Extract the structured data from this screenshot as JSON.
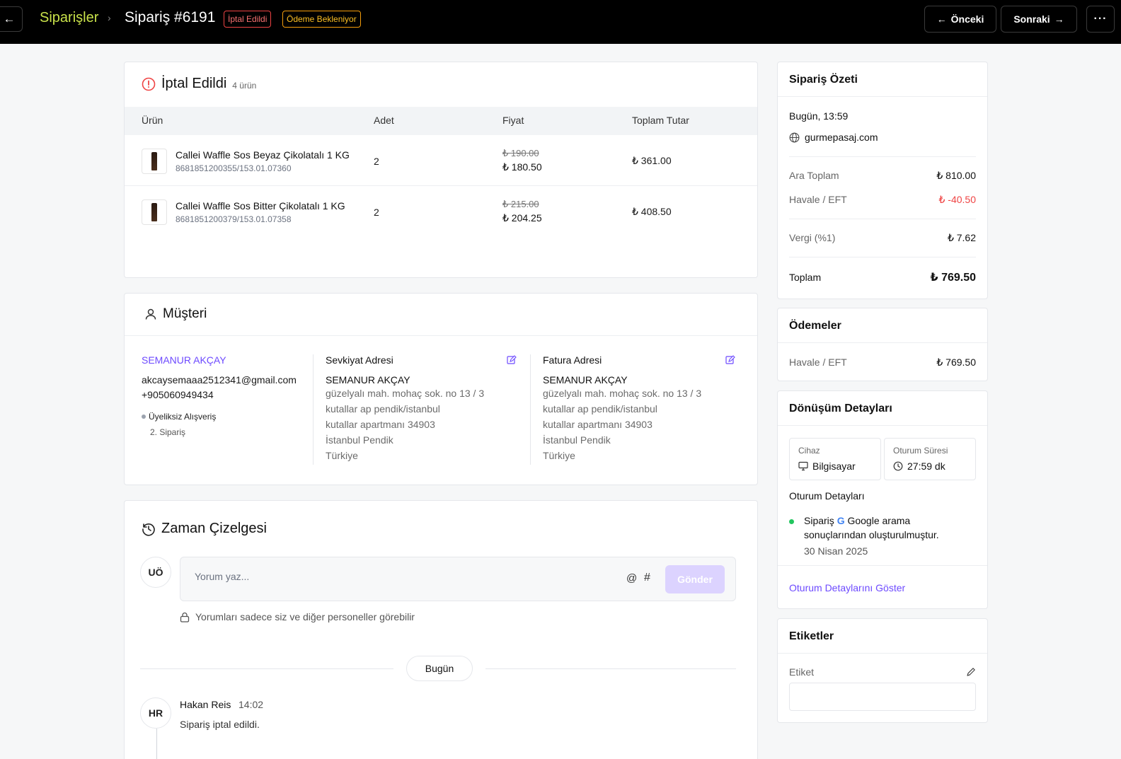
{
  "topbar": {
    "breadcrumb": "Siparişler",
    "order_title": "Sipariş #6191",
    "status_badge": "İptal Edildi",
    "payment_badge": "Ödeme Bekleniyor",
    "prev_label": "Önceki",
    "next_label": "Sonraki"
  },
  "items": {
    "title": "İptal Edildi",
    "count": "4 ürün",
    "columns": [
      "Ürün",
      "Adet",
      "Fiyat",
      "Toplam Tutar"
    ],
    "rows": [
      {
        "name": "Callei Waffle Sos Beyaz Çikolatalı 1 KG",
        "sku": "8681851200355/153.01.07360",
        "qty": "2",
        "old_price": "₺ 190.00",
        "price": "₺ 180.50",
        "total": "₺ 361.00"
      },
      {
        "name": "Callei Waffle Sos Bitter Çikolatalı 1 KG",
        "sku": "8681851200379/153.01.07358",
        "qty": "2",
        "old_price": "₺ 215.00",
        "price": "₺ 204.25",
        "total": "₺ 408.50"
      }
    ]
  },
  "customer": {
    "title": "Müşteri",
    "name": "SEMANUR AKÇAY",
    "email": "akcaysemaaa2512341@gmail.com",
    "phone": "+905060949434",
    "tag": "Üyeliksiz Alışveriş",
    "order_count": "2. Sipariş",
    "shipping": {
      "title": "Sevkiyat Adresi",
      "name": "SEMANUR AKÇAY",
      "lines": [
        "güzelyalı mah. mohaç sok. no 13 / 3",
        "kutallar ap pendik/istanbul",
        "kutallar apartmanı 34903",
        "İstanbul Pendik",
        "Türkiye"
      ]
    },
    "billing": {
      "title": "Fatura Adresi",
      "name": "SEMANUR AKÇAY",
      "lines": [
        "güzelyalı mah. mohaç sok. no 13 / 3",
        "kutallar ap pendik/istanbul",
        "kutallar apartmanı 34903",
        "İstanbul Pendik",
        "Türkiye"
      ]
    }
  },
  "timeline": {
    "title": "Zaman Çizelgesi",
    "user_initials": "UÖ",
    "comment_placeholder": "Yorum yaz...",
    "at_symbol": "@",
    "hash_symbol": "#",
    "send_label": "Gönder",
    "privacy_note": "Yorumları sadece siz ve diğer personeller görebilir",
    "day_label": "Bugün",
    "event": {
      "initials": "HR",
      "author": "Hakan Reis",
      "time": "14:02",
      "text": "Sipariş iptal edildi."
    }
  },
  "summary": {
    "title": "Sipariş Özeti",
    "date": "Bugün, 13:59",
    "site": "gurmepasaj.com",
    "subtotal_label": "Ara Toplam",
    "subtotal": "₺ 810.00",
    "discount_label": "Havale / EFT",
    "discount": "₺ -40.50",
    "tax_label": "Vergi (%1)",
    "tax": "₺ 7.62",
    "total_label": "Toplam",
    "total": "₺ 769.50"
  },
  "payments": {
    "title": "Ödemeler",
    "method": "Havale / EFT",
    "amount": "₺ 769.50"
  },
  "conversion": {
    "title": "Dönüşüm Detayları",
    "device_label": "Cihaz",
    "device": "Bilgisayar",
    "session_label": "Oturum Süresi",
    "session_duration": "27:59 dk",
    "session_details_title": "Oturum Detayları",
    "session_text_pre": "Sipariş",
    "session_text_brand": "Google",
    "session_text_post": "arama sonuçlarından oluşturulmuştur.",
    "session_date": "30 Nisan 2025",
    "show_details_link": "Oturum Detaylarını Göster"
  },
  "tags": {
    "title": "Etiketler",
    "label": "Etiket"
  },
  "colors": {
    "accent": "#6d4aff",
    "danger": "#ef4444",
    "warning": "#f59e0b",
    "breadcrumb": "#c9e24a"
  }
}
